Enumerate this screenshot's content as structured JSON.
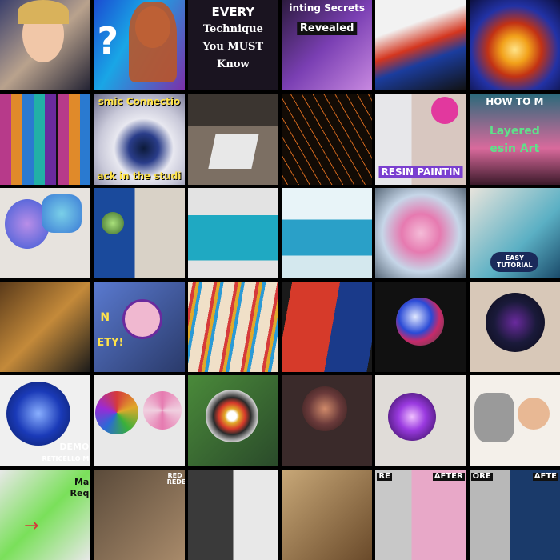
{
  "grid": {
    "rows": 6,
    "cols": 6
  },
  "captions": {
    "t0_3_a": "inting Secrets",
    "t0_3_b": "Revealed",
    "t0_2_a": "EVERY",
    "t0_2_b": "Technique",
    "t0_2_c": "You MUST",
    "t0_2_d": "Know",
    "t1_1_a": "smic Connectio",
    "t1_1_b": "ack in the studi",
    "t1_4": "RESIN PAINTIN",
    "t1_5_a": "HOW TO M",
    "t1_5_b": "Layered",
    "t1_5_c": "esin Art",
    "t2_5": "EASY TUTORIAL",
    "t3_1_a": "N",
    "t3_1_b": "ETY!",
    "t4_0_a": "DEMO",
    "t4_0_b": "RETICELLO M",
    "t5_0_a": "Ma",
    "t5_0_b": "Req",
    "t5_1": "RED REDE",
    "t5_4_a": "RE",
    "t5_4_b": "AFTER",
    "t5_5_a": "ORE",
    "t5_5_b": "AFTE"
  },
  "colors": {
    "gap": "#000000",
    "purple": "#6a2a9e",
    "teal": "#1fa9c2",
    "orange": "#e07a20",
    "resin_blue": "#2a6bd6",
    "pink": "#e76fb8"
  }
}
